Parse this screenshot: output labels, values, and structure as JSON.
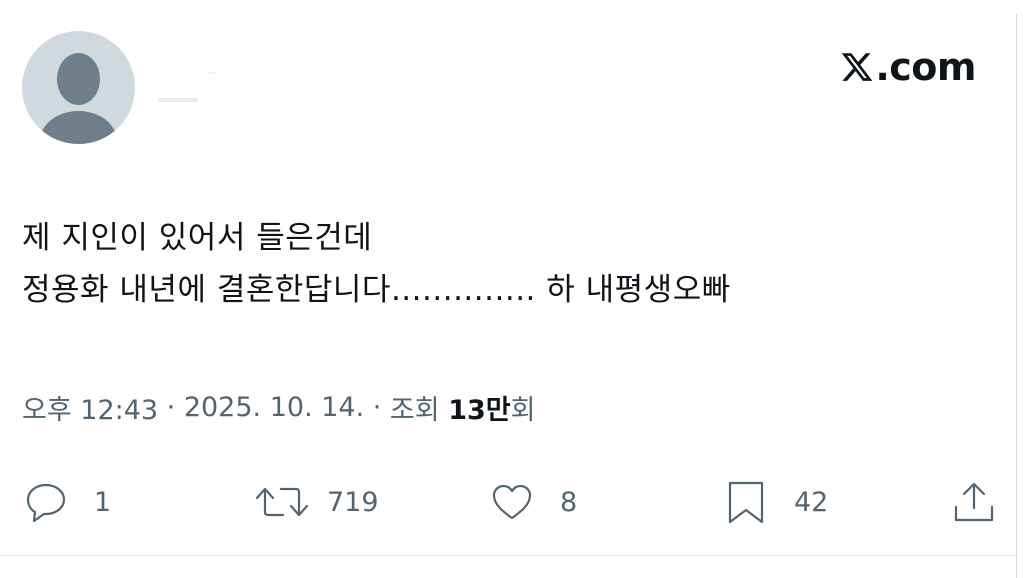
{
  "brand": {
    "suffix": ".com",
    "logo_icon": "x-logo-icon"
  },
  "tweet": {
    "lines": [
      "제 지인이 있어서 들은건데",
      "정용화 내년에 결혼한답니다.............. 하 내평생오빠"
    ]
  },
  "meta": {
    "time": "오후 12:43",
    "sep1": " · ",
    "date": "2025. 10. 14.",
    "sep2": " · ",
    "views_label": "조회 ",
    "views_num": "13만",
    "views_unit": "회"
  },
  "actions": {
    "reply": {
      "icon": "reply-icon",
      "count": "1"
    },
    "repost": {
      "icon": "repost-icon",
      "count": "719"
    },
    "like": {
      "icon": "heart-icon",
      "count": "8"
    },
    "bookmark": {
      "icon": "bookmark-icon",
      "count": "42"
    },
    "share": {
      "icon": "share-icon"
    }
  },
  "colors": {
    "text": "#0f1419",
    "secondary": "#536471",
    "avatar_bg": "#cfd9de",
    "avatar_fg": "#6e7e8b"
  }
}
